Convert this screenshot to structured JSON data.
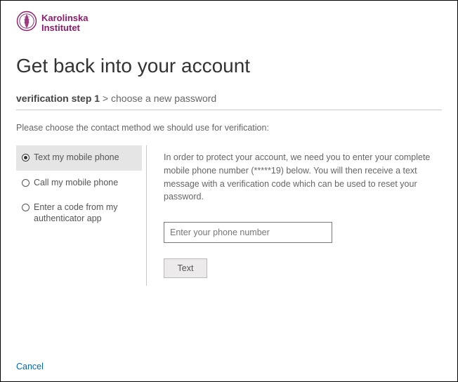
{
  "brand": {
    "line1": "Karolinska",
    "line2": "Institutet"
  },
  "title": "Get back into your account",
  "steps": {
    "current": "verification step 1",
    "sep": " > ",
    "next": "choose a new password"
  },
  "prompt": "Please choose the contact method we should use for verification:",
  "methods": {
    "text_phone": "Text my mobile phone",
    "call_phone": "Call my mobile phone",
    "auth_app": "Enter a code from my authenticator app"
  },
  "detail": {
    "text": "In order to protect your account, we need you to enter your complete mobile phone number (*****19) below. You will then receive a text message with a verification code which can be used to reset your password.",
    "placeholder": "Enter your phone number",
    "button": "Text"
  },
  "cancel": "Cancel"
}
